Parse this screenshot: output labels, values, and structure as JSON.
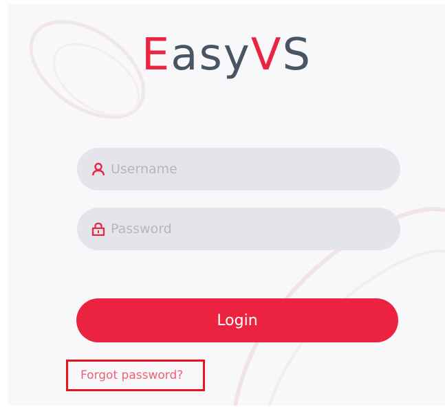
{
  "logo": {
    "part1": "E",
    "part2": "asy",
    "part3": "V",
    "part4": "S"
  },
  "username": {
    "placeholder": "Username",
    "value": "",
    "icon": "user-icon"
  },
  "password": {
    "placeholder": "Password",
    "value": "",
    "icon": "lock-icon"
  },
  "login_button": {
    "label": "Login"
  },
  "forgot": {
    "label": "Forgot password?"
  },
  "colors": {
    "brand_red": "#eb2340",
    "logo_slate": "#4a5564",
    "link_pink": "#ee5f74",
    "highlight_box": "#e8141c"
  }
}
